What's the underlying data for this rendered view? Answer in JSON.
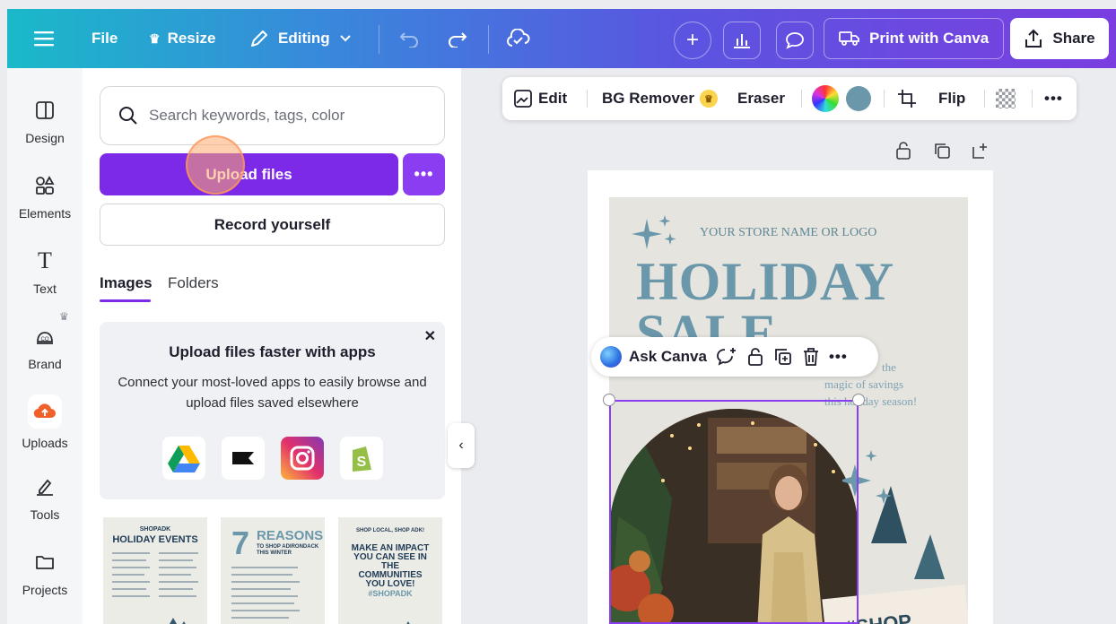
{
  "topbar": {
    "menu_icon": "hamburger-icon",
    "file_label": "File",
    "resize_label": "Resize",
    "editing_label": "Editing",
    "print_label": "Print with Canva",
    "share_label": "Share"
  },
  "rail": {
    "items": [
      {
        "label": "Design",
        "icon": "layout-icon"
      },
      {
        "label": "Elements",
        "icon": "shapes-icon"
      },
      {
        "label": "Text",
        "icon": "text-icon"
      },
      {
        "label": "Brand",
        "icon": "brand-icon"
      },
      {
        "label": "Uploads",
        "icon": "cloud-upload-icon"
      },
      {
        "label": "Tools",
        "icon": "pen-icon"
      },
      {
        "label": "Projects",
        "icon": "folder-icon"
      }
    ]
  },
  "panel": {
    "search_placeholder": "Search keywords, tags, color",
    "upload_label": "Upload files",
    "record_label": "Record yourself",
    "tabs": [
      "Images",
      "Folders"
    ],
    "promo": {
      "title": "Upload files faster with apps",
      "body": "Connect your most-loved apps to easily browse and upload files saved elsewhere",
      "apps": [
        "google-drive-icon",
        "box-icon",
        "instagram-icon",
        "shopify-icon"
      ]
    },
    "thumbs": [
      {
        "brand": "SHOPADK",
        "title": "HOLIDAY EVENTS"
      },
      {
        "brand": "7",
        "title": "REASONS",
        "sub": "TO SHOP ADIRONDACK THIS WINTER"
      },
      {
        "brand": "SHOP LOCAL, SHOP ADK!",
        "title": "MAKE AN IMPACT YOU CAN SEE IN THE COMMUNITIES YOU LOVE!",
        "sub": "#SHOPADK"
      }
    ]
  },
  "context_toolbar": {
    "edit_label": "Edit",
    "bg_remover_label": "BG Remover",
    "eraser_label": "Eraser",
    "flip_label": "Flip",
    "swatch_color": "#6b97aa"
  },
  "design": {
    "store": "YOUR STORE NAME OR LOGO",
    "headline_1": "HOLIDAY",
    "headline_2": "SALE",
    "tagline_1": "the",
    "tagline_2": "magic of savings",
    "tagline_3": "this holiday season!",
    "tag_text": "#SHOP"
  },
  "ask_canva": {
    "label": "Ask Canva"
  },
  "colors": {
    "brand_purple": "#7d2ae8",
    "headline": "#6b97aa"
  }
}
